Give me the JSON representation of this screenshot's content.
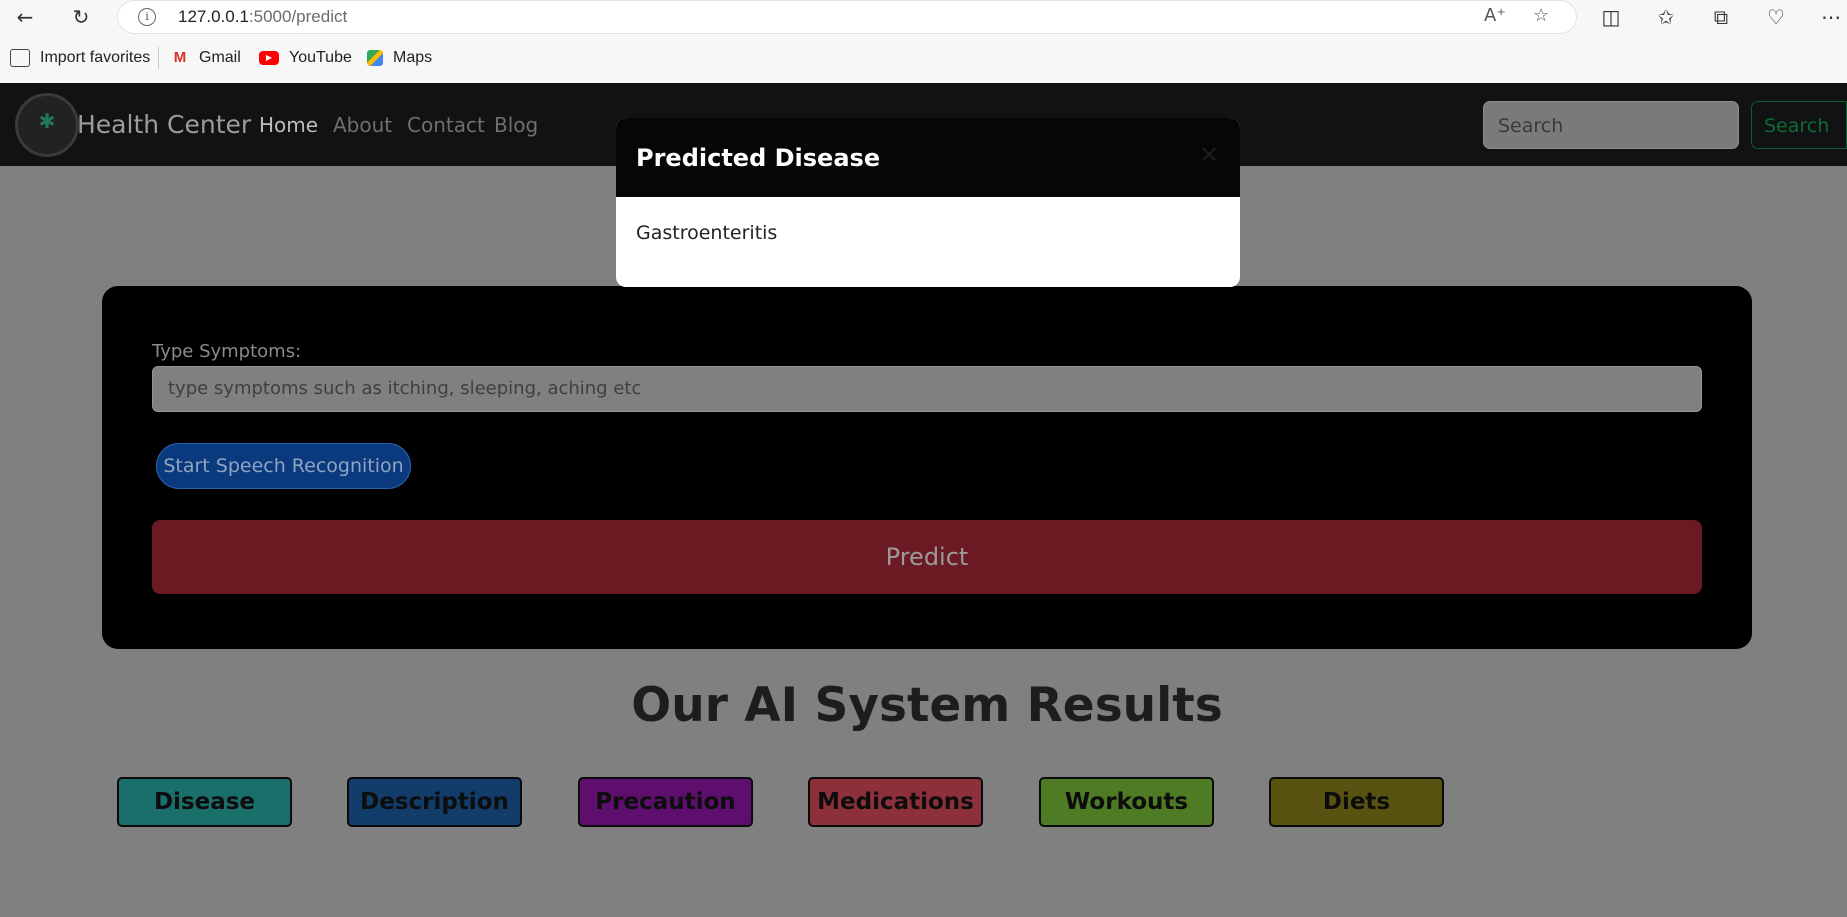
{
  "browser": {
    "url_host": "127.0.0.1",
    "url_path": ":5000/predict",
    "bookmarks": [
      {
        "label": "Import favorites",
        "icon": "import-icon",
        "color": "#444444"
      },
      {
        "label": "Gmail",
        "icon": "gmail-icon",
        "color": "#d93025"
      },
      {
        "label": "YouTube",
        "icon": "youtube-icon",
        "color": "#ff0000"
      },
      {
        "label": "Maps",
        "icon": "maps-icon",
        "color": "#34a853"
      }
    ]
  },
  "navbar": {
    "brand": "Health Center",
    "links": [
      "Home",
      "About",
      "Contact",
      "Blog"
    ],
    "search_placeholder": "Search",
    "search_button": "Search"
  },
  "form": {
    "label": "Type Symptoms:",
    "placeholder": "type symptoms such as itching, sleeping, aching etc",
    "speech_button": "Start Speech Recognition",
    "predict_button": "Predict"
  },
  "results": {
    "title": "Our AI System Results",
    "buttons": [
      {
        "label": "Disease",
        "color": "#1b6f6b"
      },
      {
        "label": "Description",
        "color": "#123c6a"
      },
      {
        "label": "Precaution",
        "color": "#5e0f6e"
      },
      {
        "label": "Medications",
        "color": "#8e2f3c"
      },
      {
        "label": "Workouts",
        "color": "#4f7b24"
      },
      {
        "label": "Diets",
        "color": "#585311"
      }
    ]
  },
  "modal": {
    "title": "Predicted Disease",
    "body": "Gastroenteritis"
  }
}
